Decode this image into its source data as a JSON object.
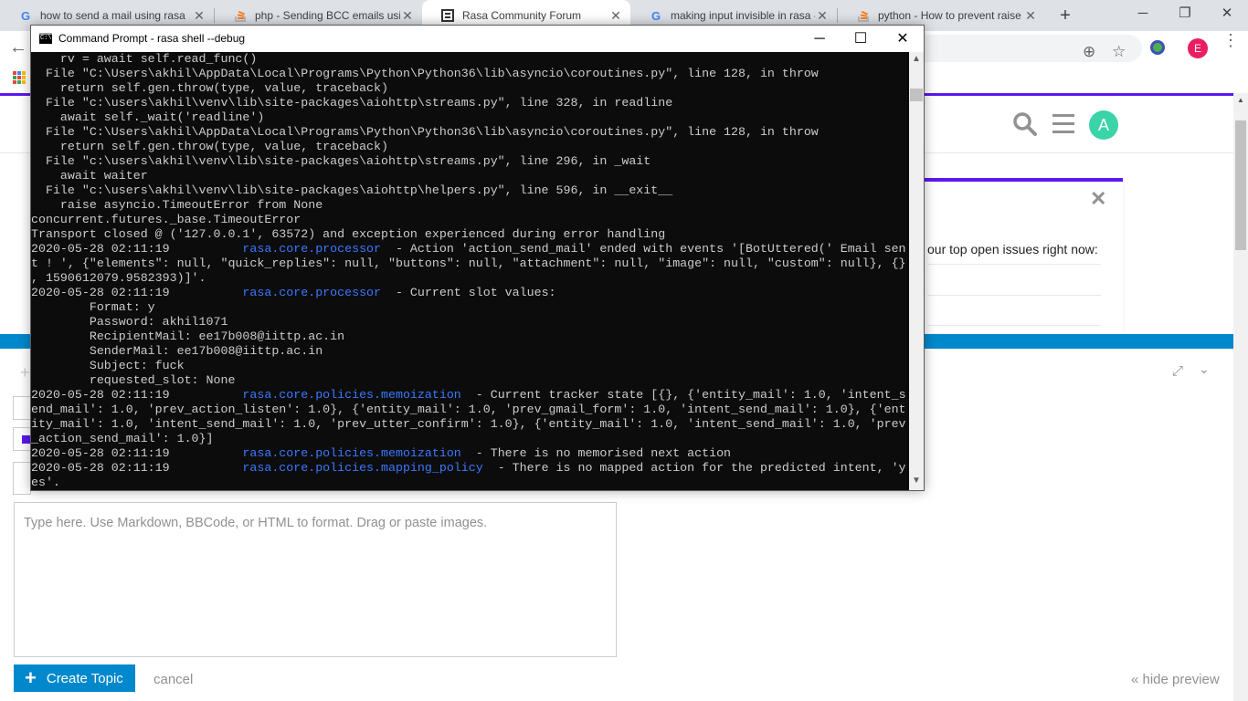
{
  "browser": {
    "tabs": [
      {
        "title": "how to send a mail using rasa",
        "icon": "google-icon",
        "active": false
      },
      {
        "title": "php - Sending BCC emails usin",
        "icon": "stackoverflow-icon",
        "active": false
      },
      {
        "title": "Rasa Community Forum",
        "icon": "rasa-forum-icon",
        "active": true
      },
      {
        "title": "making input invisible in rasa -",
        "icon": "google-icon",
        "active": false
      },
      {
        "title": "python - How to prevent raise",
        "icon": "stackoverflow-icon",
        "active": false
      }
    ],
    "profile_initial": "E"
  },
  "page": {
    "avatar_initial": "A",
    "notice_text": "our top open issues right now:",
    "editor_placeholder": "Type here. Use Markdown, BBCode, or HTML to format. Drag or paste images.",
    "create_label": "Create Topic",
    "cancel_label": "cancel",
    "hide_preview_label": "« hide preview",
    "accent_color": "#0088cc",
    "brand_color": "#5a17ee"
  },
  "cmd": {
    "title": "Command Prompt - rasa  shell --debug",
    "lines": [
      [
        {
          "t": "    rv = await self.read_func()"
        }
      ],
      [
        {
          "t": "  File \"C:\\Users\\akhil\\AppData\\Local\\Programs\\Python\\Python36\\lib\\asyncio\\coroutines.py\", line 128, in throw"
        }
      ],
      [
        {
          "t": "    return self.gen.throw(type, value, traceback)"
        }
      ],
      [
        {
          "t": "  File \"c:\\users\\akhil\\venv\\lib\\site-packages\\aiohttp\\streams.py\", line 328, in readline"
        }
      ],
      [
        {
          "t": "    await self._wait('readline')"
        }
      ],
      [
        {
          "t": "  File \"C:\\Users\\akhil\\AppData\\Local\\Programs\\Python\\Python36\\lib\\asyncio\\coroutines.py\", line 128, in throw"
        }
      ],
      [
        {
          "t": "    return self.gen.throw(type, value, traceback)"
        }
      ],
      [
        {
          "t": "  File \"c:\\users\\akhil\\venv\\lib\\site-packages\\aiohttp\\streams.py\", line 296, in _wait"
        }
      ],
      [
        {
          "t": "    await waiter"
        }
      ],
      [
        {
          "t": "  File \"c:\\users\\akhil\\venv\\lib\\site-packages\\aiohttp\\helpers.py\", line 596, in __exit__"
        }
      ],
      [
        {
          "t": "    raise asyncio.TimeoutError from None"
        }
      ],
      [
        {
          "t": "concurrent.futures._base.TimeoutError"
        }
      ],
      [
        {
          "t": "Transport closed @ ('127.0.0.1', 63572) and exception experienced during error handling"
        }
      ],
      [
        {
          "t": "2020-05-28 02:11:19          "
        },
        {
          "t": "rasa.core.processor",
          "c": "blue"
        },
        {
          "t": "  - Action 'action_send_mail' ended with events '[BotUttered(' Email sen"
        }
      ],
      [
        {
          "t": "t ! ', {\"elements\": null, \"quick_replies\": null, \"buttons\": null, \"attachment\": null, \"image\": null, \"custom\": null}, {}"
        }
      ],
      [
        {
          "t": ", 1590612079.9582393)]'."
        }
      ],
      [
        {
          "t": "2020-05-28 02:11:19          "
        },
        {
          "t": "rasa.core.processor",
          "c": "blue"
        },
        {
          "t": "  - Current slot values:"
        }
      ],
      [
        {
          "t": "        Format: y"
        }
      ],
      [
        {
          "t": "        Password: akhil1071"
        }
      ],
      [
        {
          "t": "        RecipientMail: ee17b008@iittp.ac.in"
        }
      ],
      [
        {
          "t": "        SenderMail: ee17b008@iittp.ac.in"
        }
      ],
      [
        {
          "t": "        Subject: fuck"
        }
      ],
      [
        {
          "t": "        requested_slot: None"
        }
      ],
      [
        {
          "t": "2020-05-28 02:11:19          "
        },
        {
          "t": "rasa.core.policies.memoization",
          "c": "blue"
        },
        {
          "t": "  - Current tracker state [{}, {'entity_mail': 1.0, 'intent_s"
        }
      ],
      [
        {
          "t": "end_mail': 1.0, 'prev_action_listen': 1.0}, {'entity_mail': 1.0, 'prev_gmail_form': 1.0, 'intent_send_mail': 1.0}, {'ent"
        }
      ],
      [
        {
          "t": "ity_mail': 1.0, 'intent_send_mail': 1.0, 'prev_utter_confirm': 1.0}, {'entity_mail': 1.0, 'intent_send_mail': 1.0, 'prev"
        }
      ],
      [
        {
          "t": "_action_send_mail': 1.0}]"
        }
      ],
      [
        {
          "t": "2020-05-28 02:11:19          "
        },
        {
          "t": "rasa.core.policies.memoization",
          "c": "blue"
        },
        {
          "t": "  - There is no memorised next action"
        }
      ],
      [
        {
          "t": "2020-05-28 02:11:19          "
        },
        {
          "t": "rasa.core.policies.mapping_policy",
          "c": "blue"
        },
        {
          "t": "  - There is no mapped action for the predicted intent, 'y"
        }
      ],
      [
        {
          "t": "es'."
        }
      ]
    ]
  }
}
